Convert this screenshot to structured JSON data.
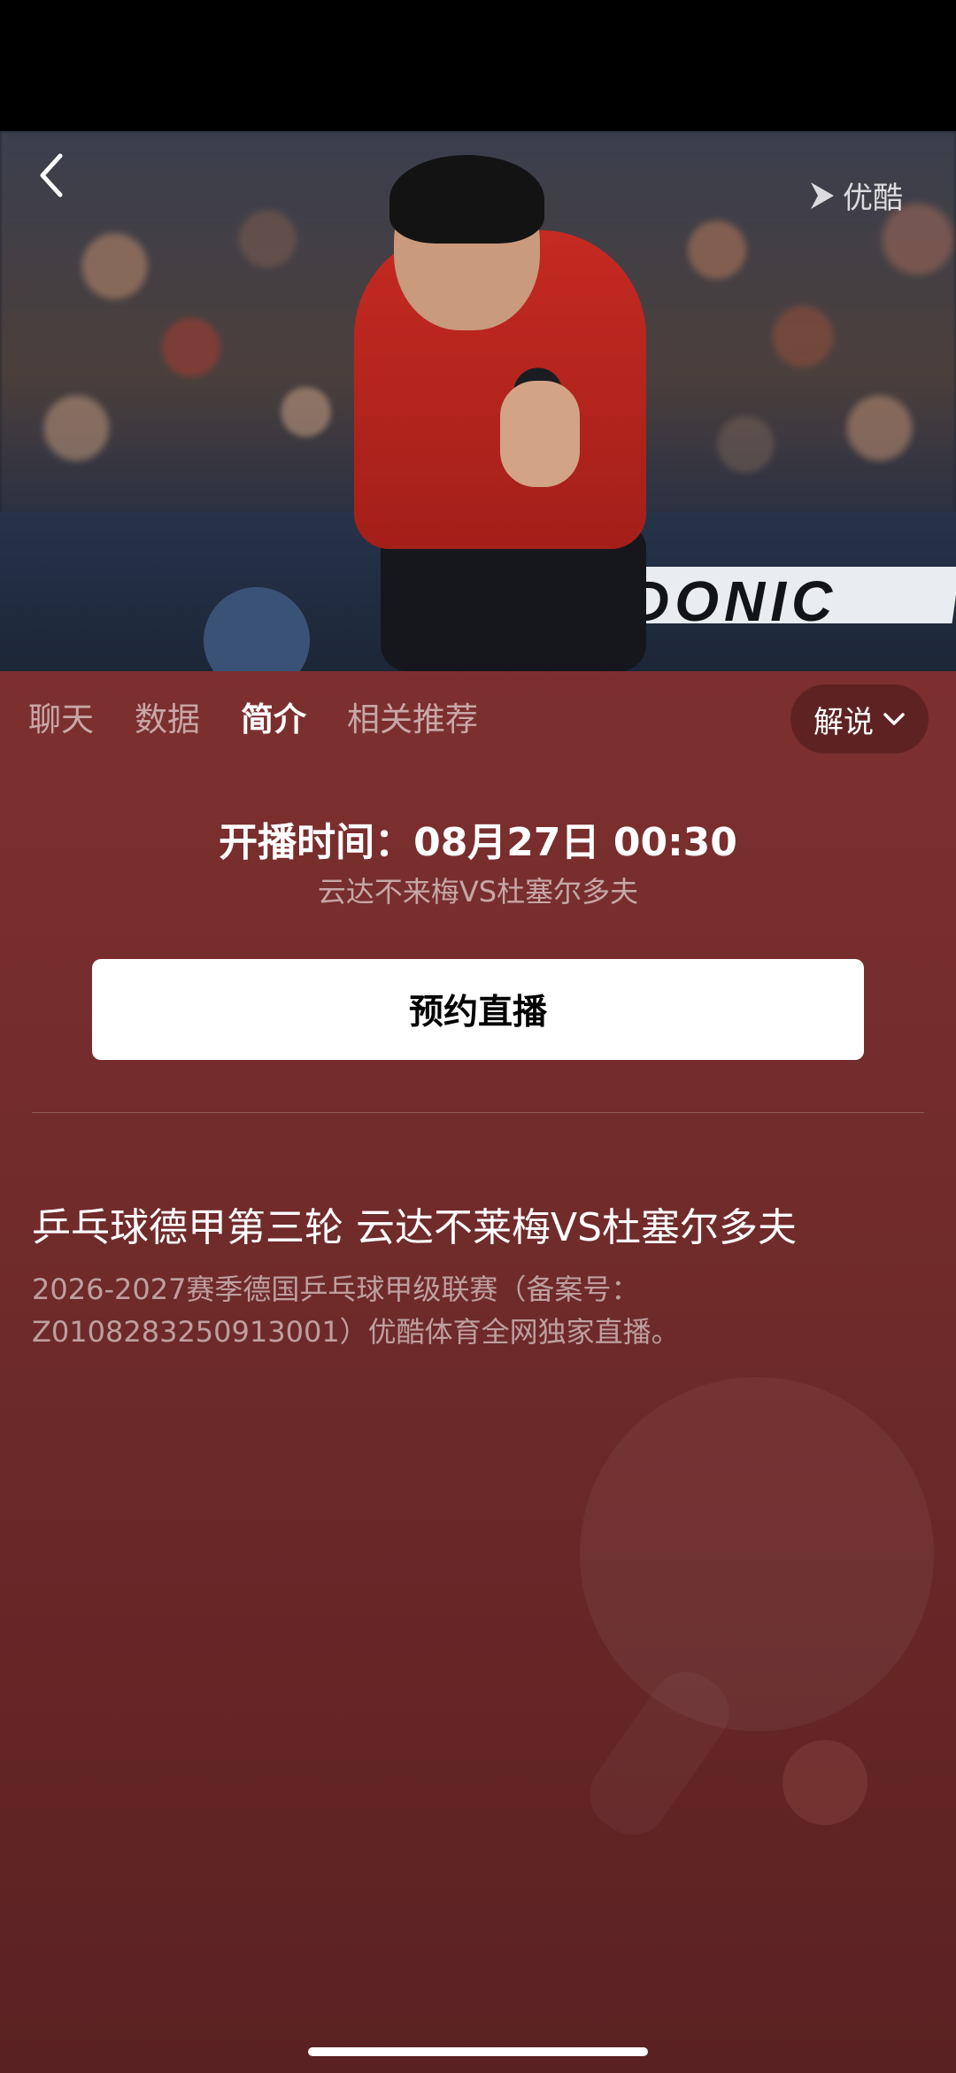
{
  "header": {
    "brand_name": "优酷"
  },
  "tabs": [
    {
      "label": "聊天",
      "active": false
    },
    {
      "label": "数据",
      "active": false
    },
    {
      "label": "简介",
      "active": true
    },
    {
      "label": "相关推荐",
      "active": false
    }
  ],
  "commentary": {
    "label": "解说"
  },
  "broadcast": {
    "start_time": "开播时间：08月27日 00:30",
    "match": "云达不来梅VS杜塞尔多夫",
    "reserve_label": "预约直播"
  },
  "event": {
    "title": "乒乓球德甲第三轮 云达不莱梅VS杜塞尔多夫",
    "description": "2026-2027赛季德国乒乓球甲级联赛（备案号：Z0108283250913001）优酷体育全网独家直播。"
  },
  "hero": {
    "board_text": "DONIC"
  },
  "colors": {
    "background": "#7c2f2f",
    "button_bg": "#ffffff"
  }
}
